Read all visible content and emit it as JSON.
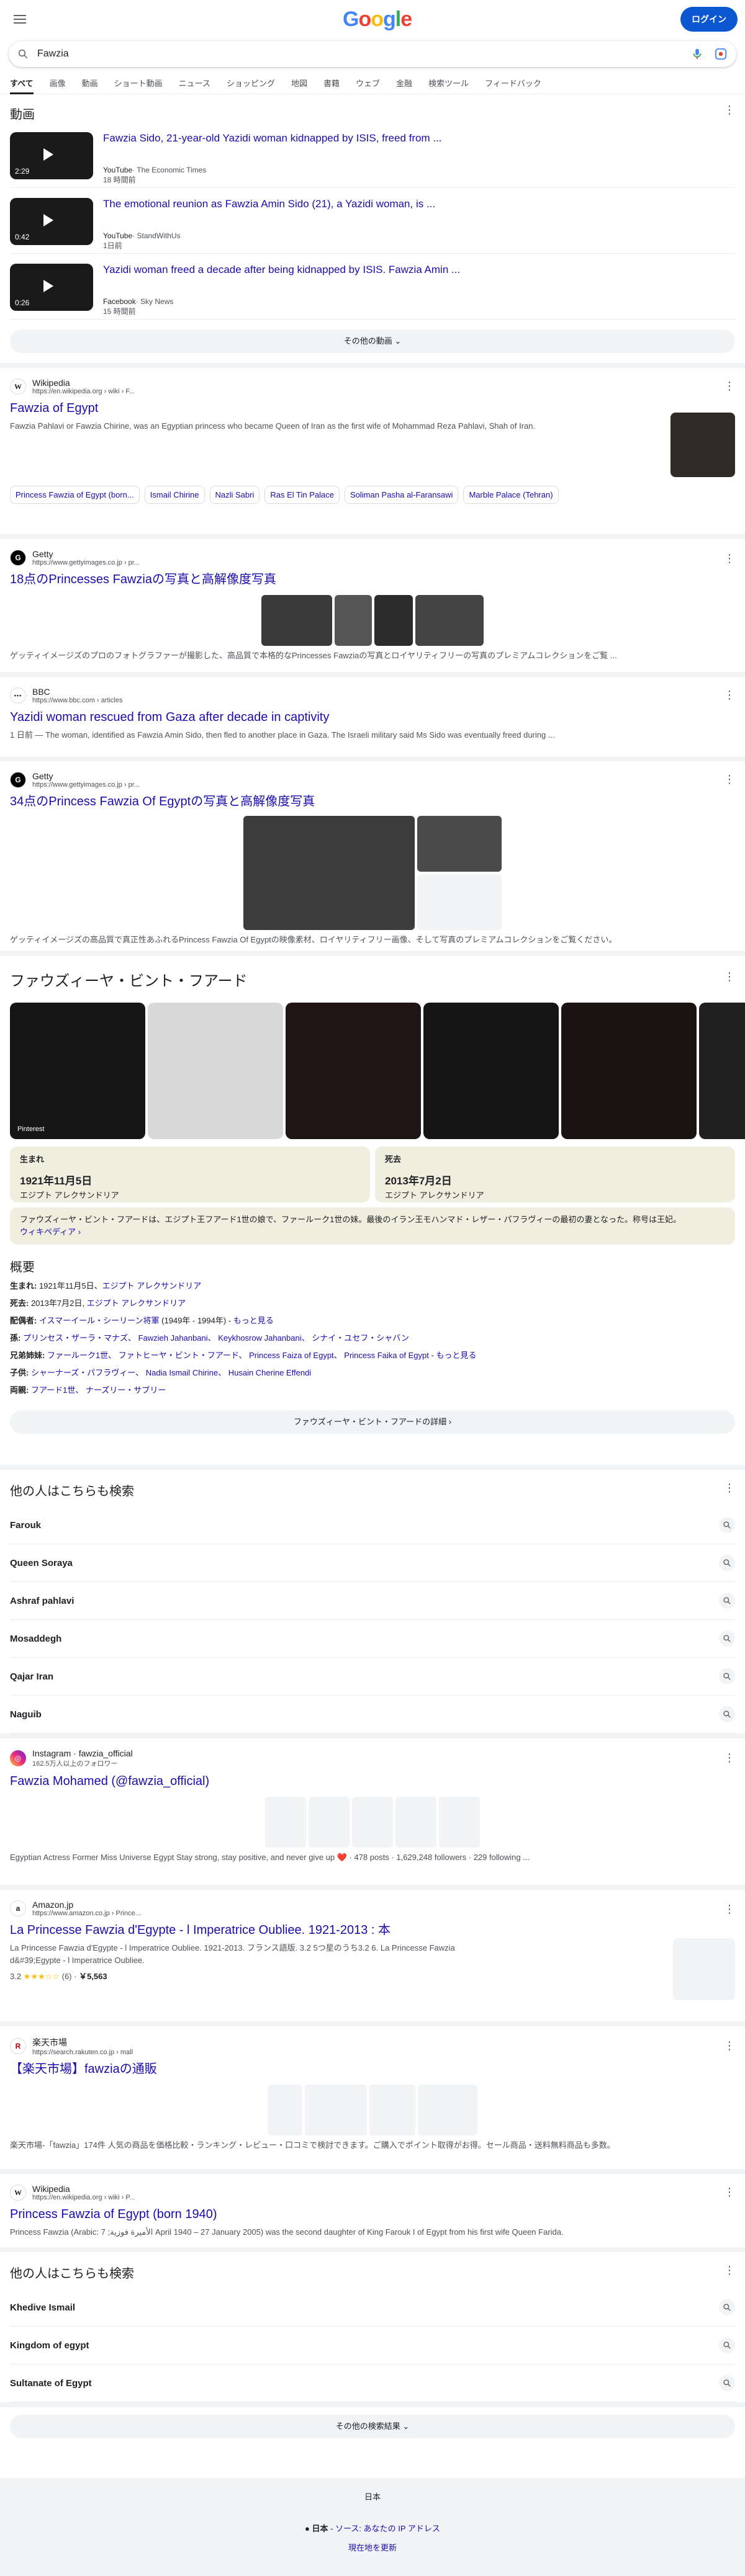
{
  "header": {
    "logo": "Google",
    "login": "ログイン"
  },
  "search": {
    "query": "Fawzia"
  },
  "tabs": [
    "すべて",
    "画像",
    "動画",
    "ショート動画",
    "ニュース",
    "ショッピング",
    "地図",
    "書籍",
    "ウェブ",
    "金融",
    "検索ツール",
    "フィードバック"
  ],
  "videos": {
    "title": "動画",
    "items": [
      {
        "title": "Fawzia Sido, 21-year-old Yazidi woman kidnapped by ISIS, freed from ...",
        "duration": "2:29",
        "source": "YouTube",
        "channel": "· The Economic Times",
        "time": "18 時間前"
      },
      {
        "title": "The emotional reunion as Fawzia Amin Sido (21), a Yazidi woman, is ...",
        "duration": "0:42",
        "source": "YouTube",
        "channel": "· StandWithUs",
        "time": "1日前"
      },
      {
        "title": "Yazidi woman freed a decade after being kidnapped by ISIS. Fawzia Amin ...",
        "duration": "0:26",
        "source": "Facebook",
        "channel": "· Sky News",
        "time": "15 時間前"
      }
    ],
    "more": "その他の動画"
  },
  "wiki": {
    "source": "Wikipedia",
    "url": "https://en.wikipedia.org › wiki › F...",
    "title": "Fawzia of Egypt",
    "snippet": "Fawzia Pahlavi or Fawzia Chirine, was an Egyptian princess who became Queen of Iran as the first wife of Mohammad Reza Pahlavi, Shah of Iran.",
    "chips": [
      "Princess Fawzia of Egypt (born...",
      "Ismail Chirine",
      "Nazli Sabri",
      "Ras El Tin Palace",
      "Soliman Pasha al-Faransawi",
      "Marble Palace (Tehran)"
    ]
  },
  "getty1": {
    "source": "Getty",
    "url": "https://www.gettyimages.co.jp › pr...",
    "title": "18点のPrincesses Fawziaの写真と高解像度写真",
    "snippet": "ゲッティイメージズのプロのフォトグラファーが撮影した、高品質で本格的なPrincesses Fawziaの写真とロイヤリティフリーの写真のプレミアムコレクションをご覧 ..."
  },
  "bbc": {
    "source": "BBC",
    "url": "https://www.bbc.com › articles",
    "title": "Yazidi woman rescued from Gaza after decade in captivity",
    "snippet": "1 日前 — The woman, identified as Fawzia Amin Sido, then fled to another place in Gaza. The Israeli military said Ms Sido was eventually freed during ..."
  },
  "getty2": {
    "source": "Getty",
    "url": "https://www.gettyimages.co.jp › pr...",
    "title": "34点のPrincess Fawzia Of Egyptの写真と高解像度写真",
    "snippet": "ゲッティイメージズの高品質で真正性あふれるPrincess Fawzia Of Egyptの映像素材、ロイヤリティフリー画像、そして写真のプレミアムコレクションをご覧ください。"
  },
  "kp": {
    "title": "ファウズィーヤ・ビント・フアード",
    "img_label": "Pinterest",
    "born_k": "生まれ",
    "born_v": "1921年11月5日",
    "born_s": "エジプト アレクサンドリア",
    "died_k": "死去",
    "died_v": "2013年7月2日",
    "died_s": "エジプト アレクサンドリア",
    "desc": "ファウズィーヤ・ビント・フアードは、エジプト王フアード1世の娘で、ファールーク1世の妹。最後のイラン王モハンマド・レザー・パフラヴィーの最初の妻となった。称号は王妃。",
    "desc_more": "ウィキペディア ›",
    "ov_title": "概要",
    "ov": [
      {
        "k": "生まれ: ",
        "v": "1921年11月5日、",
        "lk": "エジプト アレクサンドリア"
      },
      {
        "k": "死去: ",
        "v": "2013年7月2日, ",
        "lk": "エジプト アレクサンドリア"
      },
      {
        "k": "配偶者: ",
        "v": "",
        "lk": "イスマーイール・シーリーン将軍",
        "v2": " (1949年 - 1994年) - ",
        "lk2": "もっと見る"
      },
      {
        "k": "孫: ",
        "v": "",
        "lk": "プリンセス・ザーラ・マナズ、 Fawzieh Jahanbani、 Keykhosrow Jahanbani、 シナイ・ユセフ・シャバン"
      },
      {
        "k": "兄弟姉妹: ",
        "v": "",
        "lk": "ファールーク1世、 ファトヒーヤ・ビント・フアード、 Princess Faiza of Egypt、 Princess Faika of Egypt",
        "v2": " - ",
        "lk2": "もっと見る"
      },
      {
        "k": "子供: ",
        "v": "",
        "lk": "シャーナーズ・パフラヴィー、 Nadia Ismail Chirine、 Husain Cherine Effendi"
      },
      {
        "k": "両親: ",
        "v": "",
        "lk": "フアード1世、 ナーズリー・サブリー"
      }
    ],
    "more": "ファウズィーヤ・ビント・フアードの詳細"
  },
  "related1": {
    "title": "他の人はこちらも検索",
    "items": [
      "Farouk",
      "Queen Soraya",
      "Ashraf pahlavi",
      "Mosaddegh",
      "Qajar Iran",
      "Naguib"
    ]
  },
  "insta": {
    "source": "Instagram · fawzia_official",
    "url": "162.5万人以上のフォロワー",
    "title": "Fawzia Mohamed (@fawzia_official)",
    "snippet": "Egyptian Actress Former Miss Universe Egypt Stay strong, stay positive, and never give up ❤️ · 478 posts · 1,629,248 followers · 229 following ..."
  },
  "amazon": {
    "source": "Amazon.jp",
    "url": "https://www.amazon.co.jp › Prince...",
    "title": "La Princesse Fawzia d'Egypte - l Imperatrice Oubliee. 1921-2013 : 本",
    "snippet": "La Princesse Fawzia d'Egypte - l Imperatrice Oubliee. 1921-2013. フランス語版. 3.2 5つ星のうち3.2 6. La Princesse Fawzia d&#39;Egypte - l Imperatrice Oubliee.",
    "rating": "3.2",
    "reviews": "(6) · ",
    "price": "￥5,563"
  },
  "rakuten": {
    "source": "楽天市場",
    "url": "https://search.rakuten.co.jp › mall",
    "title": "【楽天市場】fawziaの通販",
    "snippet": "楽天市場-「fawzia」174件 人気の商品を価格比較・ランキング・レビュー・口コミで検討できます。ご購入でポイント取得がお得。セール商品・送料無料商品も多数。"
  },
  "wiki2": {
    "source": "Wikipedia",
    "url": "https://en.wikipedia.org › wiki › P...",
    "title": "Princess Fawzia of Egypt (born 1940)",
    "snippet": "Princess Fawzia (Arabic: الأميرة فوزية; 7 April 1940 – 27 January 2005) was the second daughter of King Farouk I of Egypt from his first wife Queen Farida."
  },
  "related2": {
    "title": "他の人はこちらも検索",
    "items": [
      "Khedive Ismail",
      "Kingdom of egypt",
      "Sultanate of Egypt"
    ]
  },
  "more_results": "その他の検索結果",
  "footer": {
    "lang": "日本",
    "loc_prefix": "日本",
    "loc_link": " - ソース: あなたの IP アドレス",
    "update": "現在地を更新"
  },
  "colors": {
    "link": "#1a0dab",
    "accent": "#0b57d0",
    "fact_bg": "#efeedf"
  }
}
